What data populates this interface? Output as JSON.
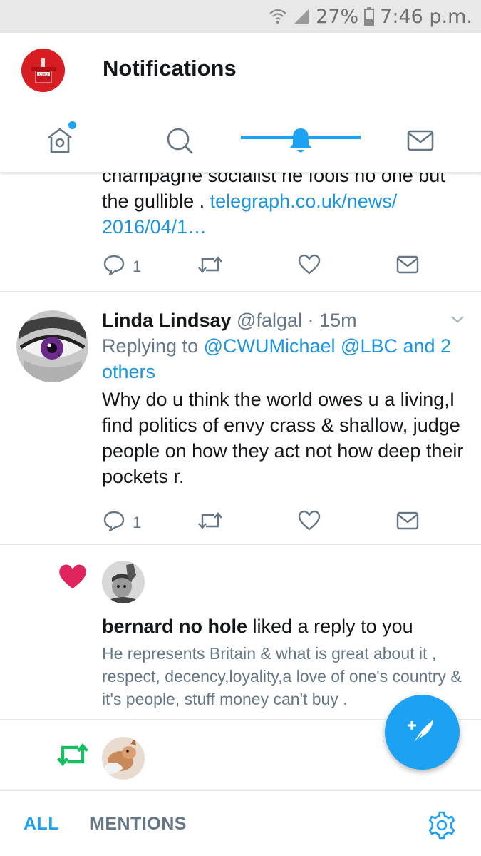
{
  "status_bar": {
    "battery": "27%",
    "time": "7:46 p.m."
  },
  "header": {
    "title": "Notifications",
    "avatar_text": "CWU",
    "tabs": [
      {
        "name": "home",
        "icon": "home-icon",
        "has_dot": true
      },
      {
        "name": "search",
        "icon": "search-icon"
      },
      {
        "name": "notifications",
        "icon": "bell-icon",
        "active": true
      },
      {
        "name": "messages",
        "icon": "mail-icon"
      }
    ]
  },
  "colors": {
    "accent": "#1da1f2",
    "link": "#1b95e0",
    "like": "#e0245e",
    "retweet": "#17bf63",
    "muted": "#657786"
  },
  "feed": {
    "tweet1": {
      "text_line1": "champagne socialist he fools no one but",
      "text_line2": "the gullible . ",
      "link_line2": "telegraph.co.uk/news/",
      "link_line3": "2016/04/1…",
      "reply_count": "1"
    },
    "tweet2": {
      "name": "Linda Lindsay",
      "handle": "@falgal",
      "separator": "·",
      "time": "15m",
      "replying_to_label": "Replying to",
      "replying_to_users": "@CWUMichael @LBC and 2",
      "replying_to_more": "others",
      "text": "Why do u think the world owes u a living,I find politics of envy crass & shallow, judge people on how they act not how deep their pockets r.",
      "reply_count": "1"
    },
    "like_notification": {
      "user": "bernard no hole",
      "action": " liked a reply to you",
      "quoted_text": "He represents Britain & what is great about it , respect, decency,loyality,a love of one's country &  it's people, stuff money can't buy ."
    },
    "retweet_notification": {
      "icon": "retweet-icon"
    }
  },
  "bottom_bar": {
    "all_label": "ALL",
    "mentions_label": "MENTIONS"
  }
}
